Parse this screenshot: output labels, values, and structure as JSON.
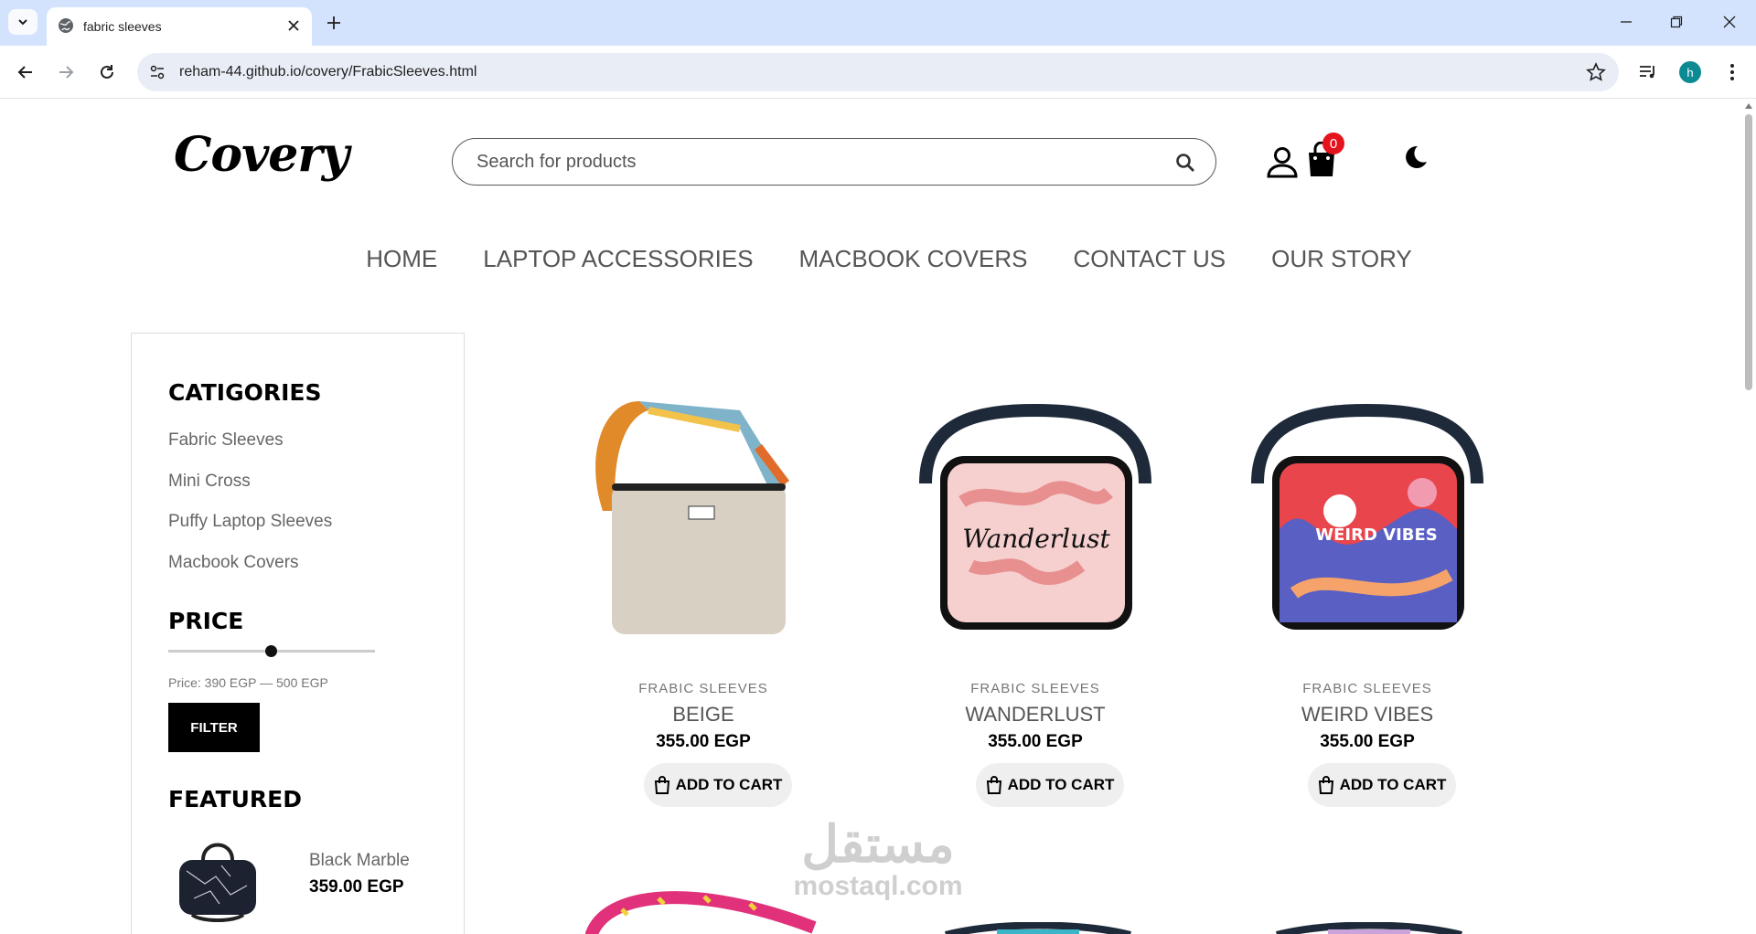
{
  "browser": {
    "tab_title": "fabric sleeves",
    "url": "reham-44.github.io/covery/FrabicSleeves.html",
    "profile_initial": "h"
  },
  "site": {
    "logo": "Covery",
    "search_placeholder": "Search for products",
    "cart_count": "0",
    "nav": [
      "HOME",
      "LAPTOP ACCESSORIES",
      "MACBOOK COVERS",
      "CONTACT US",
      "OUR STORY"
    ]
  },
  "sidebar": {
    "categories_title": "CATIGORIES",
    "categories": [
      "Fabric Sleeves",
      "Mini Cross",
      "Puffy Laptop Sleeves",
      "Macbook Covers"
    ],
    "price_title": "PRICE",
    "price_range": "Price: 390 EGP — 500 EGP",
    "filter_label": "FILTER",
    "featured_title": "FEATURED",
    "featured": {
      "name": "Black Marble",
      "price": "359.00 EGP"
    }
  },
  "products": [
    {
      "category": "FRABIC SLEEVES",
      "name": "BEIGE",
      "price": "355.00 EGP",
      "button": "ADD TO CART"
    },
    {
      "category": "FRABIC SLEEVES",
      "name": "WANDERLUST",
      "price": "355.00 EGP",
      "button": "ADD TO CART"
    },
    {
      "category": "FRABIC SLEEVES",
      "name": "WEIRD VIBES",
      "price": "355.00 EGP",
      "button": "ADD TO CART"
    }
  ],
  "watermark": {
    "arabic": "مستقل",
    "latin": "mostaql.com"
  }
}
